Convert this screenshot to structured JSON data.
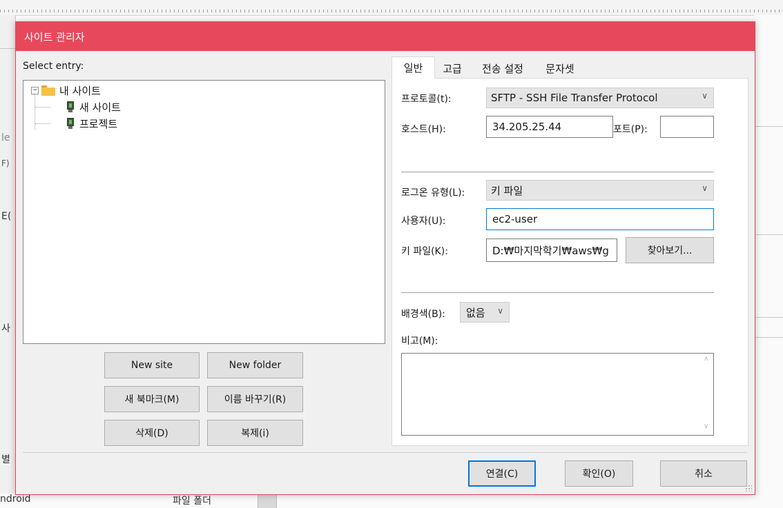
{
  "background": {
    "frag_left": [
      "le",
      "F)",
      "E(",
      "사",
      "별"
    ],
    "bottom_left": "ndroid",
    "bottom_mid": "파일 폴더"
  },
  "dialog": {
    "title": "사이트 관리자",
    "close_glyph": "✕",
    "select_entry_label": "Select entry:",
    "tree": {
      "root": {
        "label": "내 사이트",
        "expander": "−"
      },
      "children": [
        "새 사이트",
        "프로젝트"
      ]
    },
    "buttons": {
      "new_site": "New site",
      "new_folder": "New folder",
      "new_bookmark": "새 북마크(M)",
      "rename": "이름 바꾸기(R)",
      "delete": "삭제(D)",
      "duplicate": "복제(i)"
    },
    "tabs": [
      "일반",
      "고급",
      "전송 설정",
      "문자셋"
    ],
    "general": {
      "protocol_label": "프로토콜(t):",
      "protocol_value": "SFTP - SSH File Transfer Protocol",
      "host_label": "호스트(H):",
      "host_value": "34.205.25.44",
      "port_label": "포트(P):",
      "port_value": "",
      "logon_type_label": "로그온 유형(L):",
      "logon_type_value": "키 파일",
      "user_label": "사용자(U):",
      "user_value": "ec2-user",
      "keyfile_label": "키 파일(K):",
      "keyfile_value": "D:₩마지막학기₩aws₩g",
      "browse_button": "찾아보기...",
      "bgcolor_label": "배경색(B):",
      "bgcolor_value": "없음",
      "comments_label": "비고(M):",
      "comments_value": ""
    },
    "footer": {
      "connect": "연결(C)",
      "ok": "확인(O)",
      "cancel": "취소"
    },
    "icons": {
      "dropdown": "∨",
      "scroll_up": "∧",
      "scroll_down": "∨"
    }
  }
}
